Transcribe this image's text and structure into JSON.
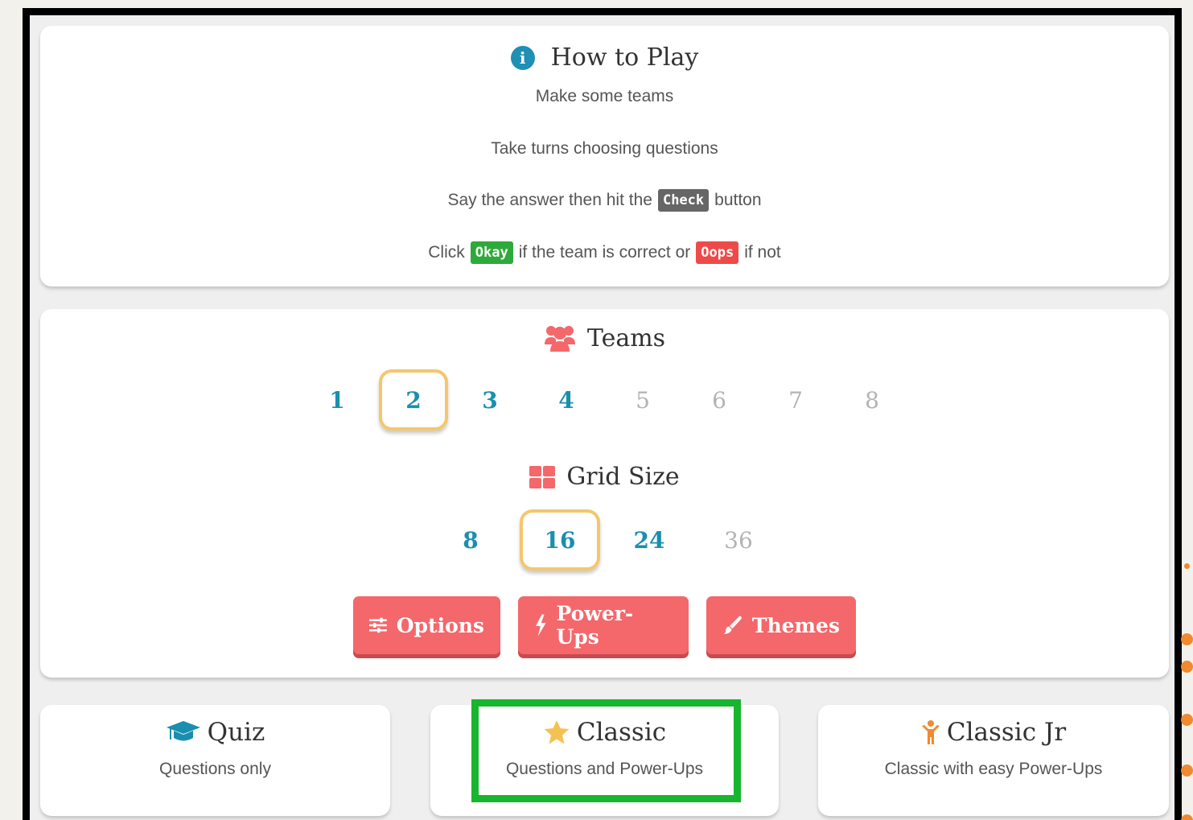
{
  "howto": {
    "title": "How to Play",
    "line1": "Make some teams",
    "line2": "Take turns choosing questions",
    "line3_pre": "Say the answer then hit the",
    "line3_chip": "Check",
    "line3_post": "button",
    "line4_pre": "Click",
    "line4_chip_okay": "Okay",
    "line4_mid": "if the team is correct or",
    "line4_chip_oops": "Oops",
    "line4_post": "if not"
  },
  "teams": {
    "title": "Teams",
    "options": [
      "1",
      "2",
      "3",
      "4",
      "5",
      "6",
      "7",
      "8"
    ],
    "selected": "2",
    "disabled": [
      "5",
      "6",
      "7",
      "8"
    ]
  },
  "grid": {
    "title": "Grid Size",
    "options": [
      "8",
      "16",
      "24",
      "36"
    ],
    "selected": "16",
    "disabled": [
      "36"
    ]
  },
  "buttons": {
    "options": "Options",
    "powerups": "Power-Ups",
    "themes": "Themes"
  },
  "modes": [
    {
      "title": "Quiz",
      "desc": "Questions only",
      "icon": "graduation-cap-icon"
    },
    {
      "title": "Classic",
      "desc": "Questions and Power-Ups",
      "icon": "star-icon"
    },
    {
      "title": "Classic Jr",
      "desc": "Classic with easy Power-Ups",
      "icon": "child-icon"
    }
  ],
  "highlighted_mode": "Classic",
  "colors": {
    "accent_teal": "#1a8eaf",
    "button_red": "#f4676b",
    "select_ring": "#f4c66e",
    "highlight_green": "#18b52f"
  }
}
